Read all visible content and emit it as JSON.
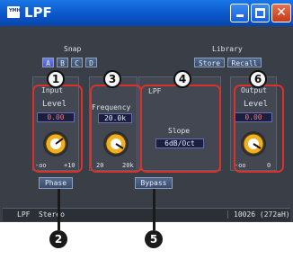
{
  "window": {
    "title": "LPF",
    "app_icon": "yamaha-logo-icon"
  },
  "snap": {
    "label": "Snap",
    "buttons": [
      "A",
      "B",
      "C",
      "D"
    ],
    "active": "A"
  },
  "library": {
    "label": "Library",
    "store": "Store",
    "recall": "Recall"
  },
  "input": {
    "title": "Input",
    "level_label": "Level",
    "value": "0.00",
    "scale_min": "-oo",
    "scale_max": "+10",
    "phase_label": "Phase"
  },
  "frequency": {
    "title": "Frequency",
    "value": "20.0k",
    "scale_min": "20",
    "scale_max": "20k"
  },
  "lpf": {
    "title": "LPF",
    "slope_label": "Slope",
    "slope_value": "6dB/Oct",
    "bypass_label": "Bypass"
  },
  "output": {
    "title": "Output",
    "level_label": "Level",
    "value": "0.00",
    "scale_min": "-oo",
    "scale_max": "0"
  },
  "status": {
    "left": "LPF",
    "center": "Stereo",
    "right": "10026 (272aH)"
  },
  "callouts": [
    "1",
    "2",
    "3",
    "4",
    "5",
    "6"
  ],
  "colors": {
    "title_bar": "#0a55c8",
    "panel_bg": "#3a3f47",
    "highlight": "#d8322a",
    "knob": "#f0b020"
  }
}
